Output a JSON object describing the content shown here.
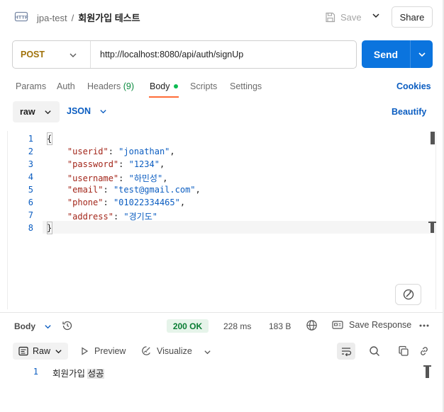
{
  "header": {
    "workspace": "jpa-test",
    "separator": "/",
    "request_name": "회원가입 테스트",
    "save_label": "Save",
    "share_label": "Share"
  },
  "request": {
    "method": "POST",
    "url": "http://localhost:8080/api/auth/signUp",
    "send_label": "Send"
  },
  "tabs": {
    "params": "Params",
    "auth": "Auth",
    "headers": "Headers",
    "headers_count": "(9)",
    "body": "Body",
    "scripts": "Scripts",
    "settings": "Settings",
    "cookies": "Cookies"
  },
  "body_options": {
    "mode": "raw",
    "language": "JSON",
    "beautify": "Beautify"
  },
  "editor": {
    "line_numbers": [
      "1",
      "2",
      "3",
      "4",
      "5",
      "6",
      "7",
      "8"
    ],
    "open_brace": "{",
    "close_brace": "}",
    "fields": [
      {
        "key": "\"userid\"",
        "value": "\"jonathan\"",
        "trail": ","
      },
      {
        "key": "\"password\"",
        "value": "\"1234\"",
        "trail": ","
      },
      {
        "key": "\"username\"",
        "value": "\"하민성\"",
        "trail": ","
      },
      {
        "key": "\"email\"",
        "value": "\"test@gmail.com\"",
        "trail": ","
      },
      {
        "key": "\"phone\"",
        "value": "\"01022334465\"",
        "trail": ","
      },
      {
        "key": "\"address\"",
        "value": "\"경기도\"",
        "trail": ""
      }
    ]
  },
  "response": {
    "body_tab": "Body",
    "status": "200 OK",
    "time": "228 ms",
    "size": "183 B",
    "save_response": "Save Response",
    "format": "Raw",
    "preview": "Preview",
    "visualize": "Visualize",
    "line_number": "1",
    "text_plain": "회원가입 ",
    "text_highlight": "성공"
  },
  "colors": {
    "accent": "#ff6c37",
    "send": "#0b74de",
    "method": "#a0720a",
    "status": "#0a7d34",
    "link": "#0b5dc1"
  }
}
